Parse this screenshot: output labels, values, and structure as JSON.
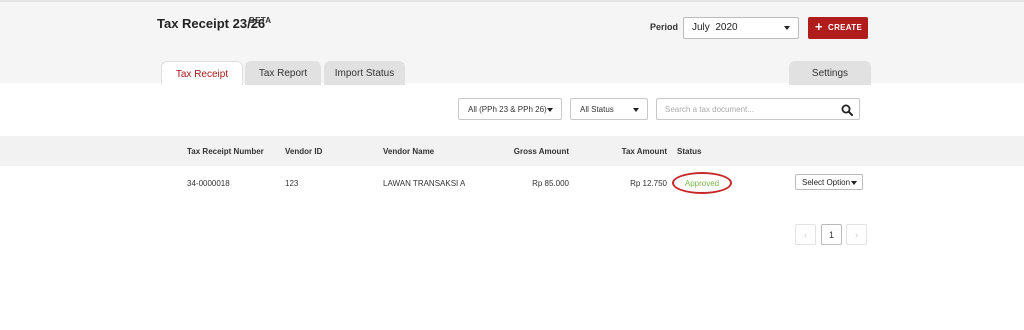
{
  "header": {
    "title": "Tax Receipt 23/26",
    "badge": "BETA",
    "period_label": "Period",
    "period_value": "July  2020",
    "create_label": "CREATE",
    "create_icon": "+"
  },
  "tabs": [
    {
      "label": "Tax Receipt",
      "active": true
    },
    {
      "label": "Tax Report",
      "active": false
    },
    {
      "label": "Import Status",
      "active": false
    }
  ],
  "settings_tab": "Settings",
  "filters": {
    "type_value": "All (PPh 23 & PPh 26)",
    "status_value": "All Status",
    "search_placeholder": "Search a tax document..."
  },
  "table": {
    "headers": [
      "Tax Receipt Number",
      "Vendor ID",
      "Vendor Name",
      "Gross Amount",
      "Tax Amount",
      "Status"
    ],
    "rows": [
      {
        "number": "34-0000018",
        "vendor_id": "123",
        "vendor_name": "LAWAN TRANSAKSI A",
        "gross": "Rp 85.000",
        "tax": "Rp 12.750",
        "status": "Approved",
        "action": "Select Option"
      }
    ]
  },
  "pagination": {
    "prev": "‹",
    "page": "1",
    "next": "›"
  },
  "colors": {
    "accent": "#b01c1c",
    "status_approved": "#7ab648",
    "highlight_ring": "#c62828"
  }
}
